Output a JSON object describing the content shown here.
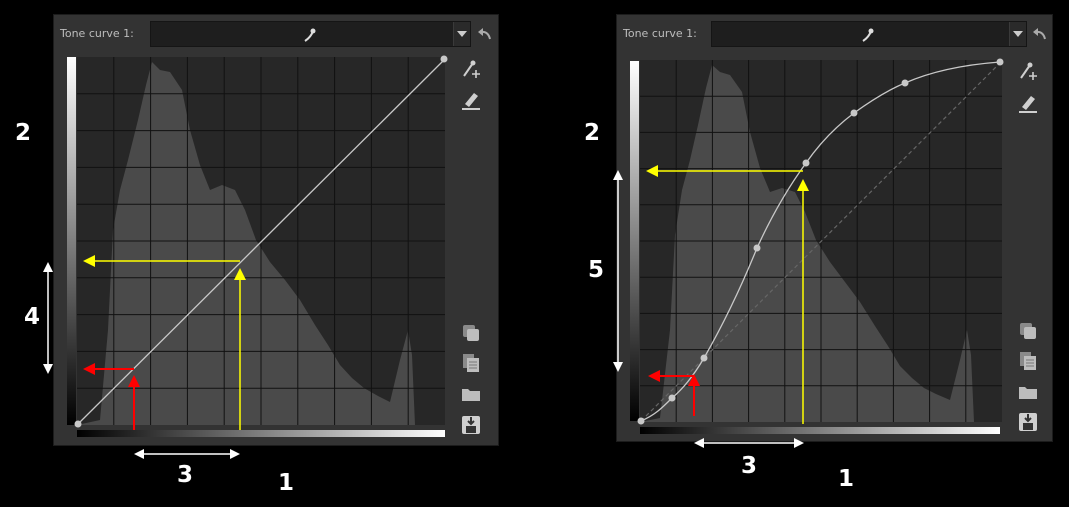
{
  "panels": [
    {
      "title": "Tone curve 1:"
    },
    {
      "title": "Tone curve 1:"
    }
  ],
  "annotations": {
    "left": {
      "n1": "1",
      "n2": "2",
      "n3": "3",
      "n4": "4"
    },
    "right": {
      "n1": "1",
      "n2": "2",
      "n3": "3",
      "n5": "5"
    }
  },
  "icons": {
    "combo": "curve-preset-icon",
    "reset": "reset-arrow-icon",
    "side": [
      "point-picker-icon",
      "edit-pencil-icon",
      "copy-icon",
      "paste-icon",
      "open-folder-icon",
      "save-icon"
    ]
  },
  "colors": {
    "yellow_guide": "#ffff00",
    "red_guide": "#ff0000",
    "curve": "#c8c8c8",
    "histogram": "#4a4a4a"
  }
}
